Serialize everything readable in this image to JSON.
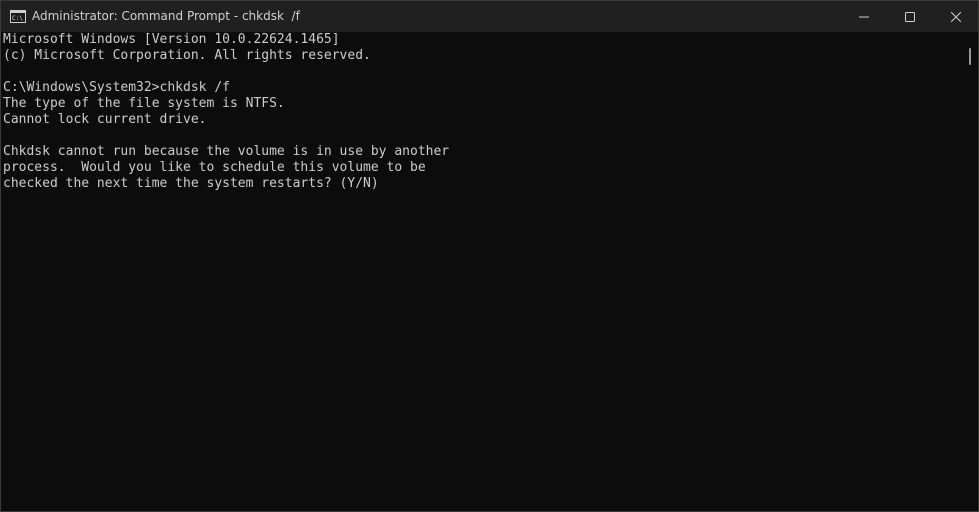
{
  "window": {
    "title": "Administrator: Command Prompt - chkdsk  /f",
    "icon": "command-prompt-icon",
    "controls": {
      "minimize": "minimize-icon",
      "maximize": "maximize-icon",
      "close": "close-icon"
    }
  },
  "console": {
    "lines": [
      "Microsoft Windows [Version 10.0.22624.1465]",
      "(c) Microsoft Corporation. All rights reserved.",
      "",
      "C:\\Windows\\System32>chkdsk /f",
      "The type of the file system is NTFS.",
      "Cannot lock current drive.",
      "",
      "Chkdsk cannot run because the volume is in use by another",
      "process.  Would you like to schedule this volume to be",
      "checked the next time the system restarts? (Y/N)"
    ]
  },
  "colors": {
    "background": "#0c0c0c",
    "titlebar": "#202020",
    "text": "#cccccc"
  }
}
